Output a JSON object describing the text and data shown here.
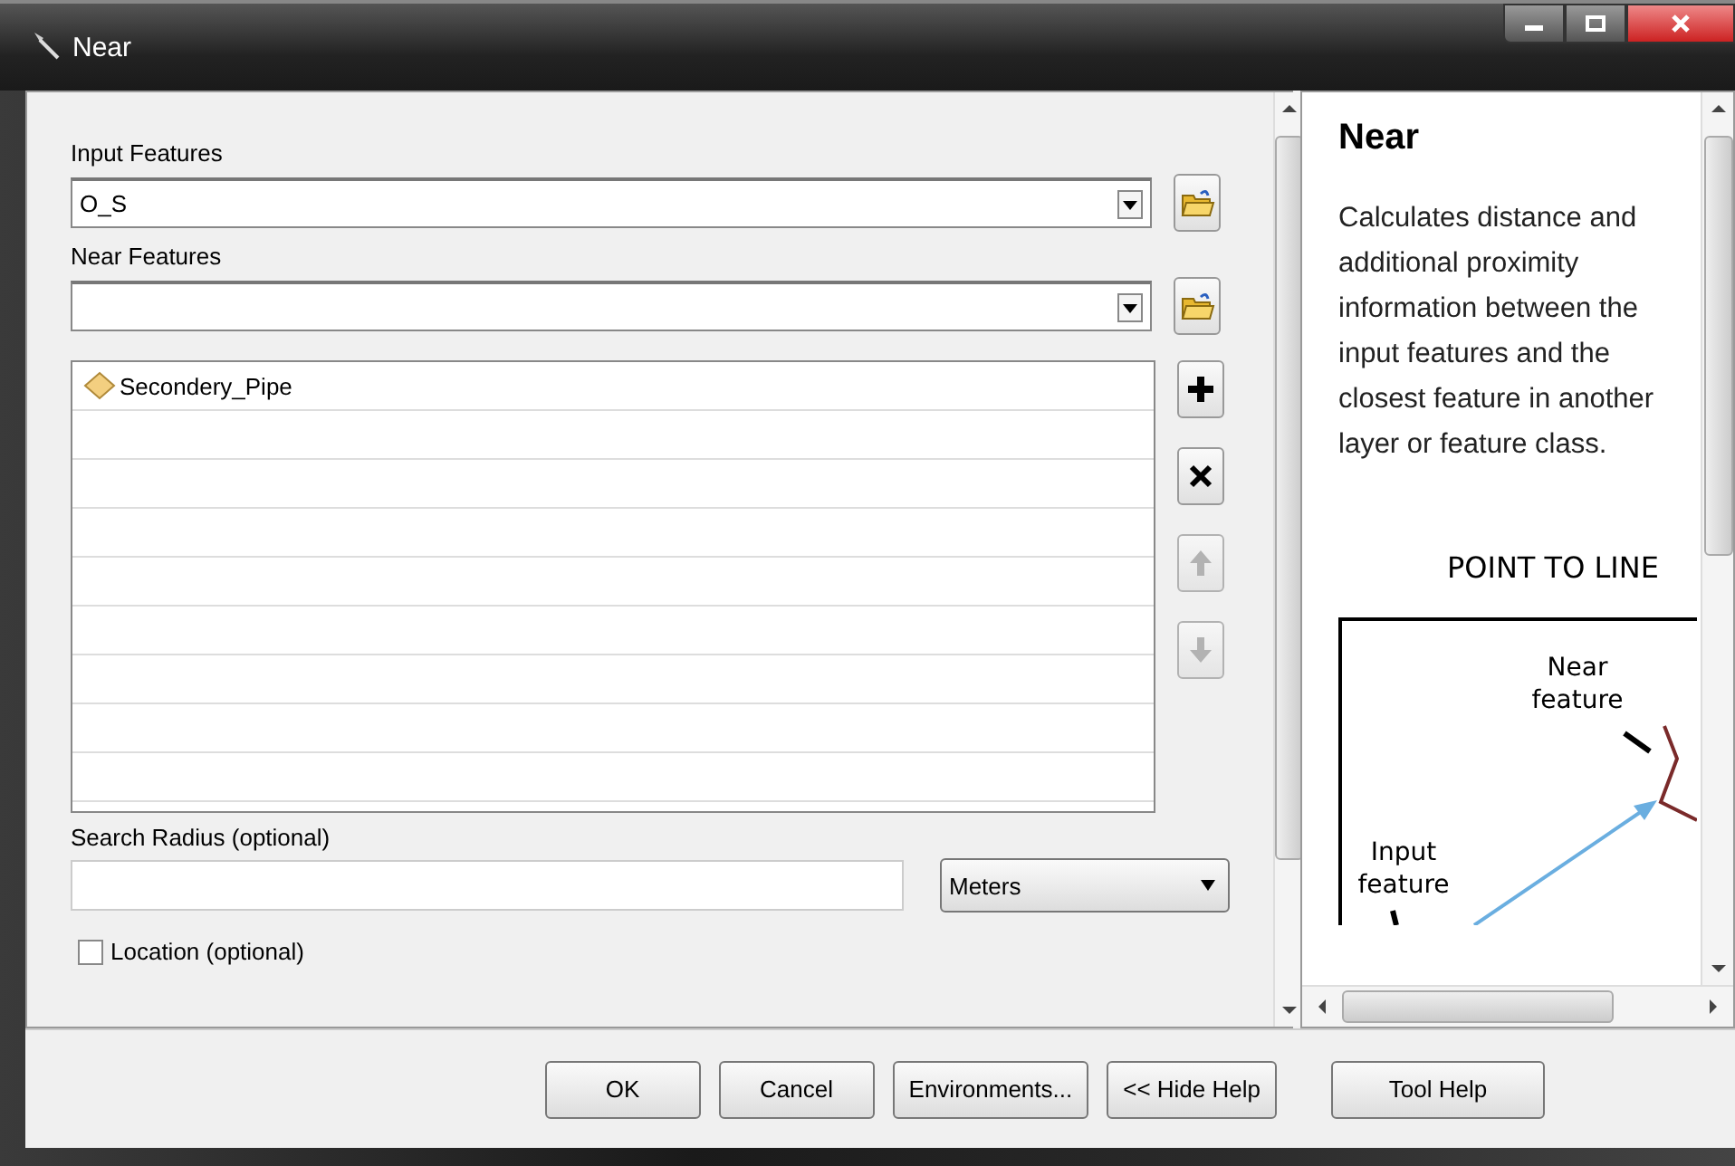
{
  "window": {
    "title": "Near"
  },
  "form": {
    "input_features": {
      "label": "Input Features",
      "value": "O_S"
    },
    "near_features": {
      "label": "Near Features"
    },
    "near_list": [
      {
        "name": "Secondery_Pipe"
      }
    ],
    "list_buttons": [
      {
        "kind": "add",
        "disabled": false
      },
      {
        "kind": "remove",
        "disabled": false
      },
      {
        "kind": "up",
        "disabled": true
      },
      {
        "kind": "down",
        "disabled": true
      }
    ],
    "search_radius": {
      "label": "Search Radius (optional)",
      "unit": "Meters"
    },
    "location": {
      "label": "Location (optional)",
      "checked": false
    }
  },
  "help": {
    "title": "Near",
    "description": "Calculates distance and additional proximity information between the input features and the closest feature in another layer or feature class.",
    "diagram_title": "POINT TO LINE",
    "diagram_labels": [
      {
        "kind": "near",
        "text": "Near\nfeature"
      },
      {
        "kind": "input",
        "text": "Input\nfeature"
      }
    ]
  },
  "buttons": [
    {
      "label": "OK",
      "kind": "main"
    },
    {
      "label": "Cancel",
      "kind": "main"
    },
    {
      "label": "Environments...",
      "kind": "main"
    },
    {
      "label": "<< Hide Help",
      "kind": "main"
    },
    {
      "label": "Tool Help",
      "kind": "help"
    }
  ]
}
